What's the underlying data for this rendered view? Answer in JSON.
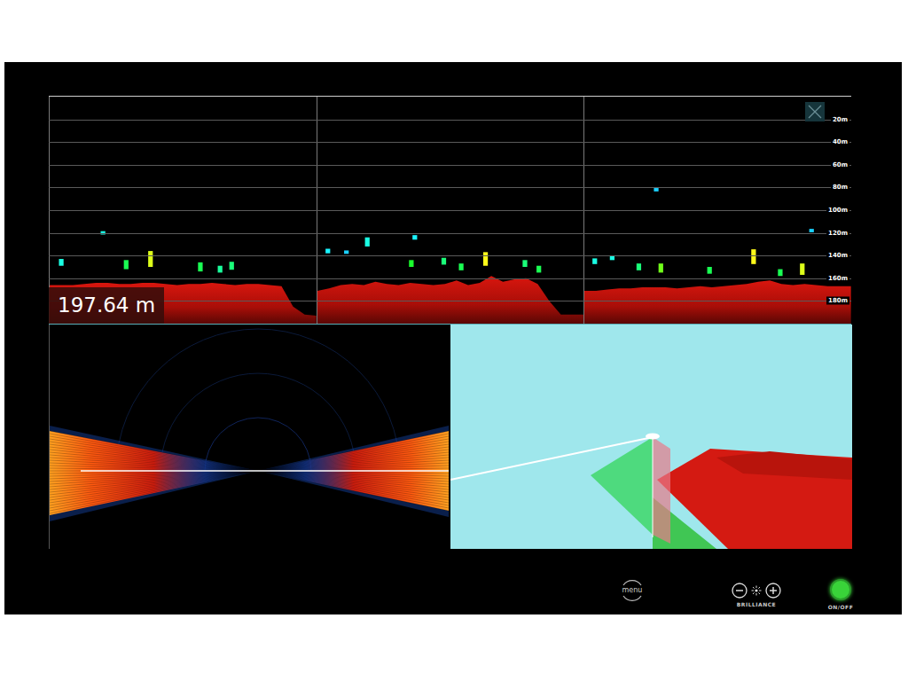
{
  "echogram": {
    "max_depth": 200,
    "ticks": [
      "20m",
      "40m",
      "60m",
      "80m",
      "100m",
      "120m",
      "140m",
      "160m",
      "180m"
    ],
    "reading": "197.64 m",
    "columns": [
      {
        "bottom": [
          166,
          166,
          166,
          165,
          164,
          164,
          165,
          165,
          164,
          164,
          165,
          166,
          165,
          165,
          164,
          165,
          166,
          165,
          165,
          166,
          167,
          185,
          192,
          193
        ],
        "echoes": [
          {
            "sample": 1,
            "depth": 146,
            "height": 6,
            "strength": 0.3
          },
          {
            "sample": 4.6,
            "depth": 120,
            "height": 3,
            "strength": 0.3
          },
          {
            "sample": 6.6,
            "depth": 148,
            "height": 8,
            "strength": 0.5
          },
          {
            "sample": 8.7,
            "depth": 143,
            "height": 14,
            "strength": 0.85
          },
          {
            "sample": 13,
            "depth": 150,
            "height": 8,
            "strength": 0.5
          },
          {
            "sample": 14.7,
            "depth": 152,
            "height": 6,
            "strength": 0.4
          },
          {
            "sample": 15.7,
            "depth": 149,
            "height": 7,
            "strength": 0.45
          }
        ]
      },
      {
        "bottom": [
          171,
          169,
          166,
          165,
          166,
          163,
          165,
          166,
          164,
          165,
          166,
          165,
          162,
          166,
          164,
          158,
          163,
          161,
          160,
          165,
          180,
          192,
          192,
          192
        ],
        "echoes": [
          {
            "sample": 0.9,
            "depth": 136,
            "height": 4,
            "strength": 0.25
          },
          {
            "sample": 2.5,
            "depth": 137,
            "height": 3,
            "strength": 0.2
          },
          {
            "sample": 4.3,
            "depth": 128,
            "height": 8,
            "strength": 0.3
          },
          {
            "sample": 8.4,
            "depth": 124,
            "height": 4,
            "strength": 0.25
          },
          {
            "sample": 8.1,
            "depth": 147,
            "height": 6,
            "strength": 0.55
          },
          {
            "sample": 10.9,
            "depth": 145,
            "height": 6,
            "strength": 0.45
          },
          {
            "sample": 12.4,
            "depth": 150,
            "height": 6,
            "strength": 0.5
          },
          {
            "sample": 14.5,
            "depth": 143,
            "height": 12,
            "strength": 0.9
          },
          {
            "sample": 17.9,
            "depth": 147,
            "height": 6,
            "strength": 0.45
          },
          {
            "sample": 19.1,
            "depth": 152,
            "height": 6,
            "strength": 0.5
          }
        ]
      },
      {
        "bottom": [
          171,
          171,
          170,
          169,
          169,
          168,
          168,
          168,
          169,
          168,
          167,
          168,
          167,
          166,
          165,
          163,
          162,
          165,
          166,
          165,
          166,
          167,
          167,
          167
        ],
        "echoes": [
          {
            "sample": 0.9,
            "depth": 145,
            "height": 5,
            "strength": 0.3
          },
          {
            "sample": 2.4,
            "depth": 142,
            "height": 4,
            "strength": 0.3
          },
          {
            "sample": 4.7,
            "depth": 150,
            "height": 6,
            "strength": 0.45
          },
          {
            "sample": 6.2,
            "depth": 82,
            "height": 3,
            "strength": 0.2
          },
          {
            "sample": 6.6,
            "depth": 151,
            "height": 8,
            "strength": 0.7
          },
          {
            "sample": 10.8,
            "depth": 153,
            "height": 6,
            "strength": 0.5
          },
          {
            "sample": 14.6,
            "depth": 141,
            "height": 13,
            "strength": 0.9
          },
          {
            "sample": 16.9,
            "depth": 155,
            "height": 6,
            "strength": 0.5
          },
          {
            "sample": 18.8,
            "depth": 152,
            "height": 10,
            "strength": 0.85
          },
          {
            "sample": 19.6,
            "depth": 118,
            "height": 3,
            "strength": 0.2
          }
        ]
      }
    ]
  },
  "controls": {
    "menu": {
      "label": "menu"
    },
    "brilliance": {
      "label": "BRILLIANCE"
    },
    "power": {
      "label": "ON/OFF",
      "on": true
    }
  }
}
